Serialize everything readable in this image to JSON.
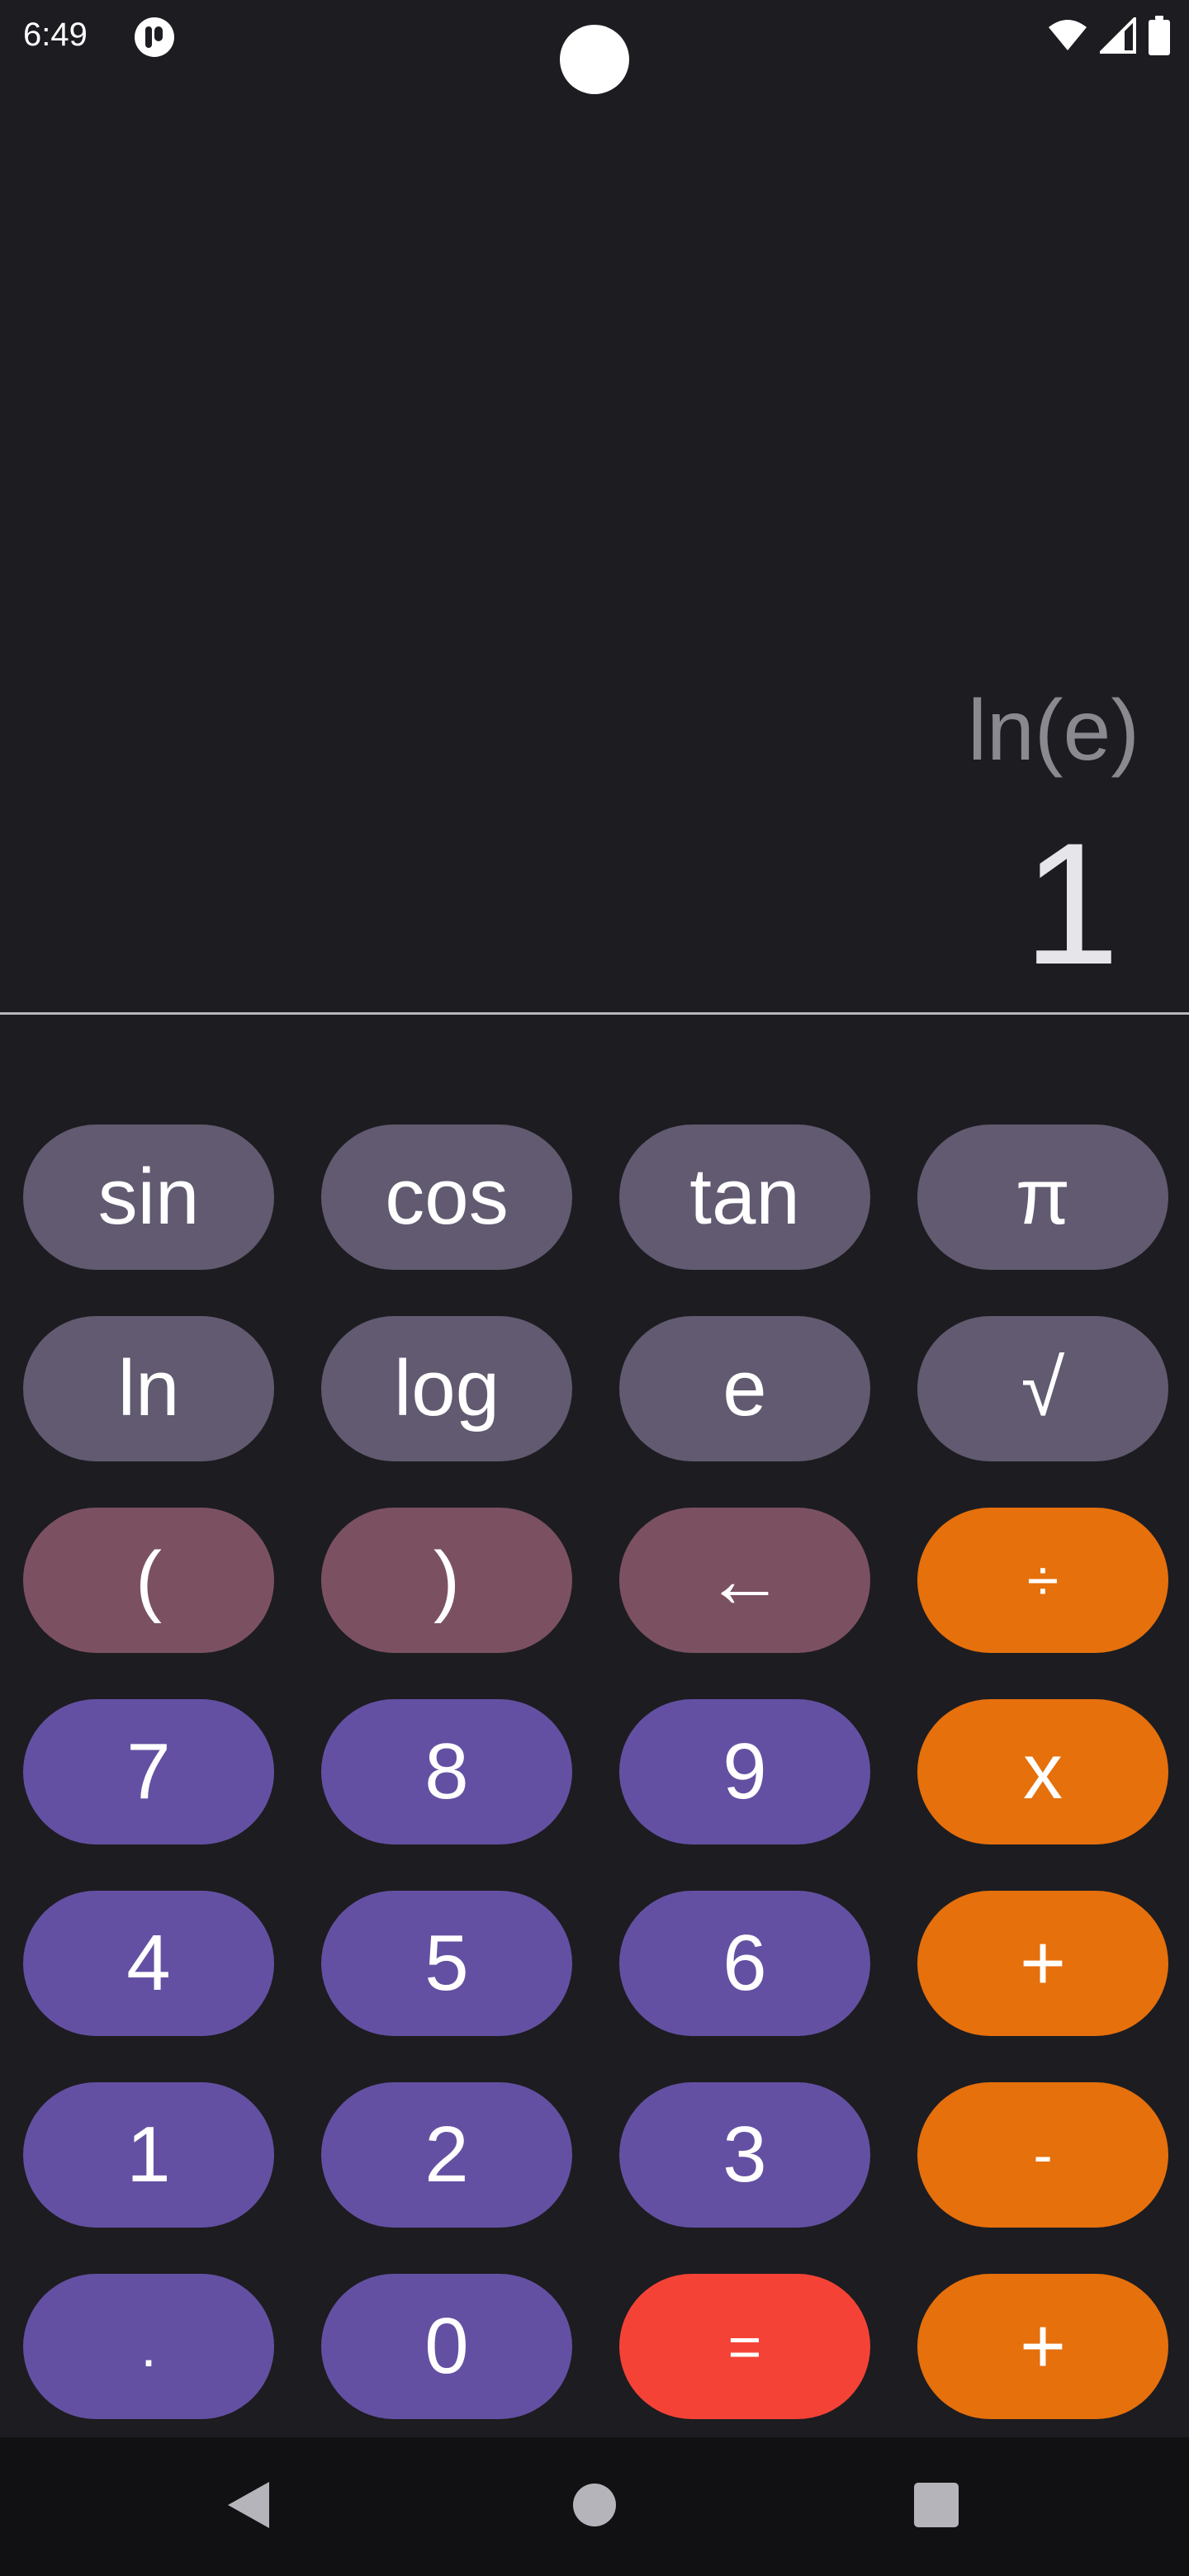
{
  "status_bar": {
    "time": "6:49"
  },
  "display": {
    "expression": "ln(e)",
    "result": "1"
  },
  "keys": [
    {
      "label": "sin",
      "name": "sin-key",
      "kind": "fn"
    },
    {
      "label": "cos",
      "name": "cos-key",
      "kind": "fn"
    },
    {
      "label": "tan",
      "name": "tan-key",
      "kind": "fn"
    },
    {
      "label": "π",
      "name": "pi-key",
      "kind": "fn"
    },
    {
      "label": "ln",
      "name": "ln-key",
      "kind": "fn"
    },
    {
      "label": "log",
      "name": "log-key",
      "kind": "fn"
    },
    {
      "label": "e",
      "name": "e-key",
      "kind": "fn"
    },
    {
      "label": "√",
      "name": "sqrt-key",
      "kind": "fn"
    },
    {
      "label": "(",
      "name": "open-paren-key",
      "kind": "paren"
    },
    {
      "label": ")",
      "name": "close-paren-key",
      "kind": "paren"
    },
    {
      "label": "←",
      "name": "backspace-key",
      "kind": "paren"
    },
    {
      "label": "÷",
      "name": "divide-key",
      "kind": "op"
    },
    {
      "label": "7",
      "name": "digit-7-key",
      "kind": "num"
    },
    {
      "label": "8",
      "name": "digit-8-key",
      "kind": "num"
    },
    {
      "label": "9",
      "name": "digit-9-key",
      "kind": "num"
    },
    {
      "label": "x",
      "name": "multiply-key",
      "kind": "op"
    },
    {
      "label": "4",
      "name": "digit-4-key",
      "kind": "num"
    },
    {
      "label": "5",
      "name": "digit-5-key",
      "kind": "num"
    },
    {
      "label": "6",
      "name": "digit-6-key",
      "kind": "num"
    },
    {
      "label": "+",
      "name": "plus-key",
      "kind": "op"
    },
    {
      "label": "1",
      "name": "digit-1-key",
      "kind": "num"
    },
    {
      "label": "2",
      "name": "digit-2-key",
      "kind": "num"
    },
    {
      "label": "3",
      "name": "digit-3-key",
      "kind": "num"
    },
    {
      "label": "-",
      "name": "minus-key",
      "kind": "op"
    },
    {
      "label": ".",
      "name": "decimal-key",
      "kind": "num"
    },
    {
      "label": "0",
      "name": "digit-0-key",
      "kind": "num"
    },
    {
      "label": "=",
      "name": "equals-key",
      "kind": "eq"
    },
    {
      "label": "+",
      "name": "plus-key-bottom",
      "kind": "op"
    }
  ],
  "colors": {
    "background": "#1d1c21",
    "function_key": "#615a70",
    "paren_key": "#7b5161",
    "number_key": "#6450a2",
    "operator_key": "#e5700c",
    "equals_key": "#f44336",
    "nav_bar": "#111113"
  },
  "icons": {
    "status_app": "app-notification-icon",
    "wifi": "wifi-icon",
    "signal": "signal-icon",
    "battery": "battery-icon",
    "nav_back": "back-triangle-icon",
    "nav_home": "home-circle-icon",
    "nav_recents": "recents-square-icon"
  }
}
